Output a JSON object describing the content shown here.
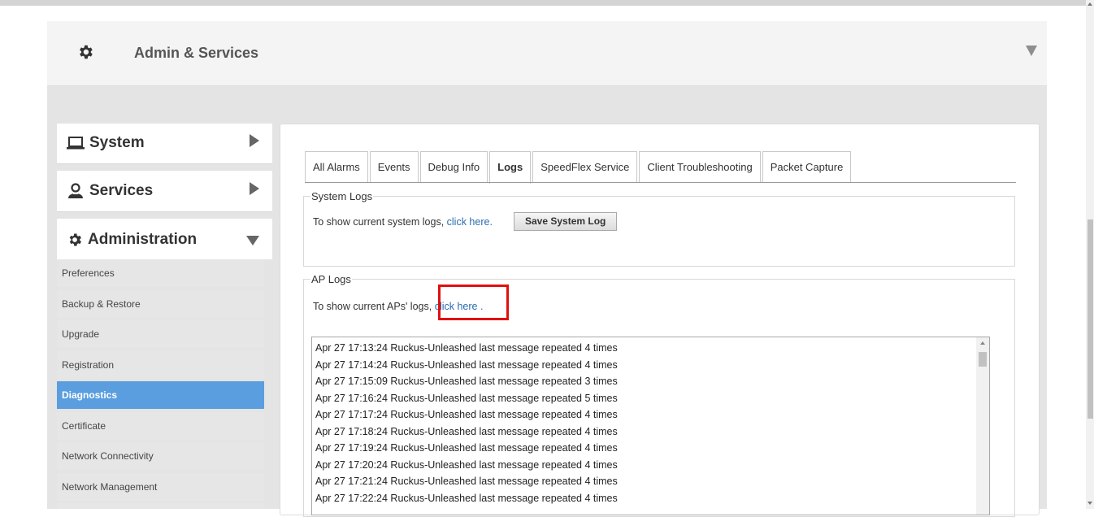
{
  "header": {
    "title": "Admin & Services",
    "icon": "gear-icon"
  },
  "sidebar": {
    "sections": [
      {
        "label": "System",
        "icon": "laptop-icon",
        "state": "collapsed"
      },
      {
        "label": "Services",
        "icon": "services-icon",
        "state": "collapsed"
      },
      {
        "label": "Administration",
        "icon": "gear-icon",
        "state": "expanded"
      }
    ],
    "items": [
      {
        "label": "Preferences"
      },
      {
        "label": "Backup & Restore"
      },
      {
        "label": "Upgrade"
      },
      {
        "label": "Registration"
      },
      {
        "label": "Diagnostics",
        "active": true
      },
      {
        "label": "Certificate"
      },
      {
        "label": "Network Connectivity"
      },
      {
        "label": "Network Management"
      }
    ]
  },
  "tabs": [
    {
      "label": "All Alarms"
    },
    {
      "label": "Events"
    },
    {
      "label": "Debug Info"
    },
    {
      "label": "Logs",
      "active": true
    },
    {
      "label": "SpeedFlex Service"
    },
    {
      "label": "Client Troubleshooting"
    },
    {
      "label": "Packet Capture"
    }
  ],
  "system_logs": {
    "legend": "System Logs",
    "text": "To show current system logs,",
    "link": "click here.",
    "button": "Save System Log"
  },
  "ap_logs": {
    "legend": "AP Logs",
    "text": "To show current APs' logs,",
    "link": "click here .",
    "lines": [
      "Apr 27 17:13:24 Ruckus-Unleashed last message repeated 4 times",
      "Apr 27 17:14:24 Ruckus-Unleashed last message repeated 4 times",
      "Apr 27 17:15:09 Ruckus-Unleashed last message repeated 3 times",
      "Apr 27 17:16:24 Ruckus-Unleashed last message repeated 5 times",
      "Apr 27 17:17:24 Ruckus-Unleashed last message repeated 4 times",
      "Apr 27 17:18:24 Ruckus-Unleashed last message repeated 4 times",
      "Apr 27 17:19:24 Ruckus-Unleashed last message repeated 4 times",
      "Apr 27 17:20:24 Ruckus-Unleashed last message repeated 4 times",
      "Apr 27 17:21:24 Ruckus-Unleashed last message repeated 4 times",
      "Apr 27 17:22:24 Ruckus-Unleashed last message repeated 4 times"
    ]
  },
  "colors": {
    "accent": "#5a9ee0",
    "highlight": "#e01010",
    "link": "#2b6cb0"
  }
}
